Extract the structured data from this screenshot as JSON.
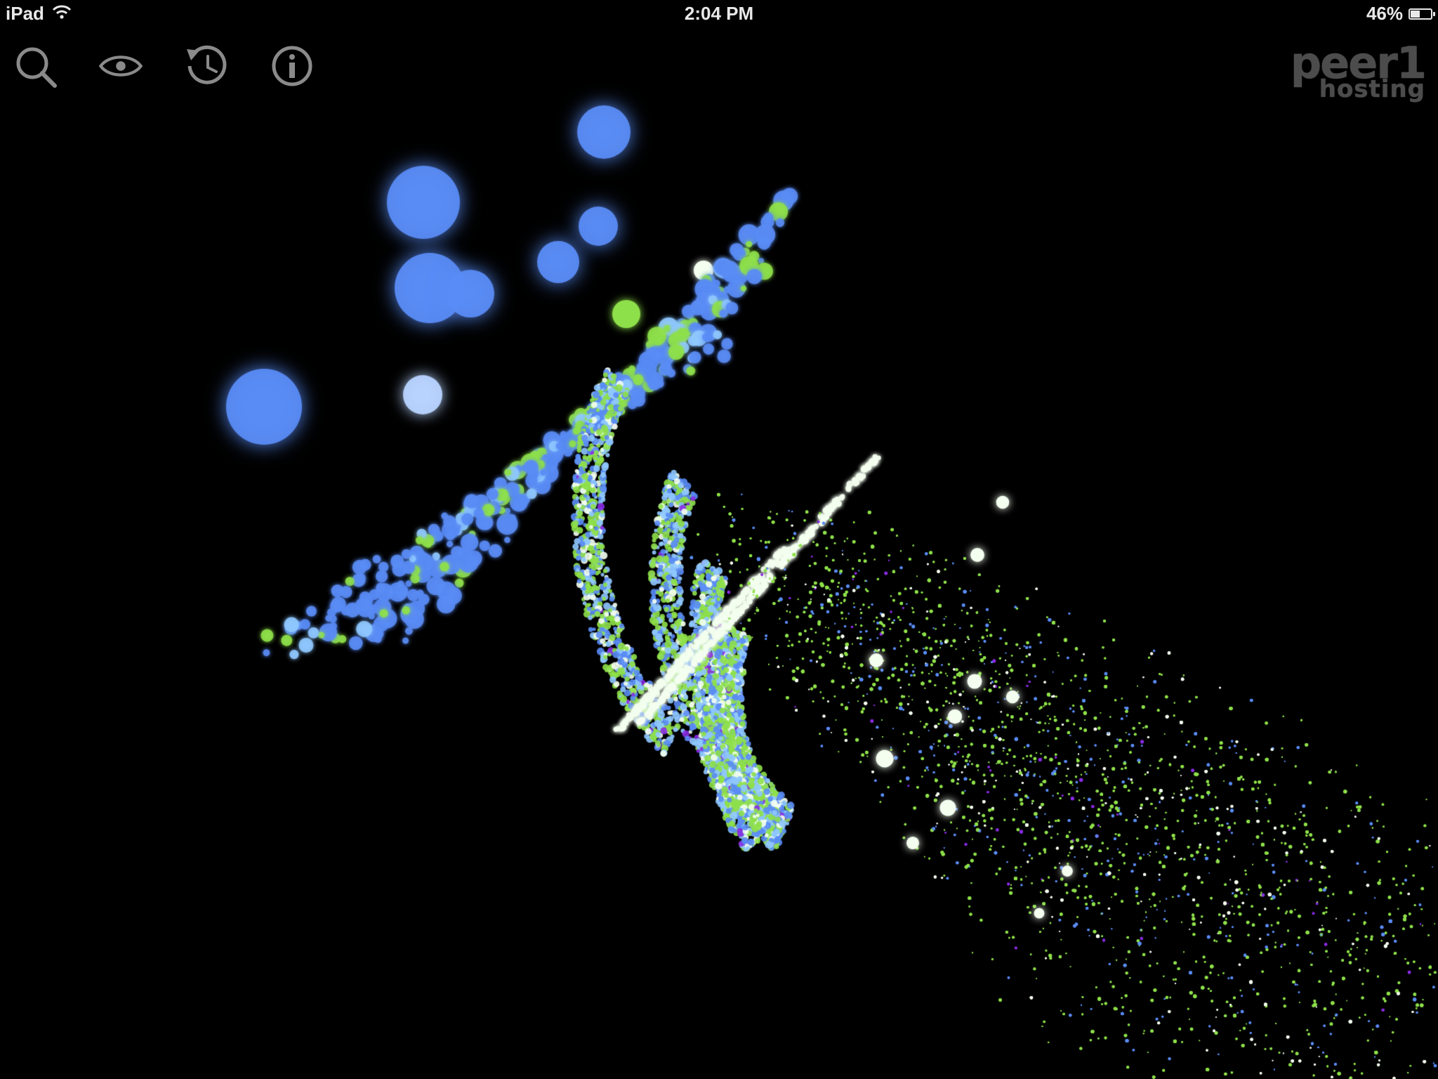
{
  "status_bar": {
    "device": "iPad",
    "time": "2:04 PM",
    "battery": "46%",
    "battery_level": 0.46
  },
  "toolbar": {
    "buttons": [
      {
        "icon": "search-icon"
      },
      {
        "icon": "eye-icon"
      },
      {
        "icon": "history-icon"
      },
      {
        "icon": "info-icon"
      }
    ]
  },
  "logo": {
    "main": "peer1",
    "sub": "hosting"
  },
  "visualization": {
    "colors": {
      "blue": "#5a8cf5",
      "light_blue": "#8fc8ff",
      "green": "#8ee04a",
      "white": "#f4fff0",
      "purple": "#8a2be2",
      "background": "#000000"
    }
  }
}
